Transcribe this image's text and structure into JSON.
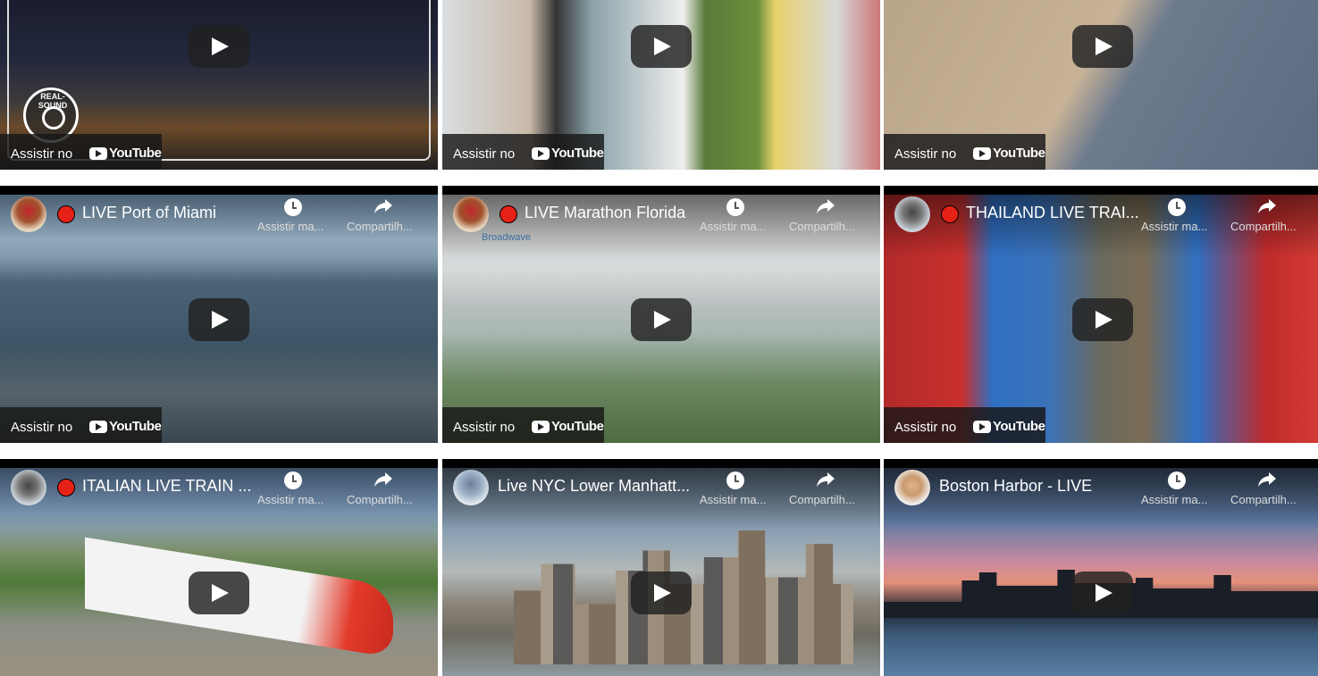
{
  "watch_label": "Assistir no",
  "youtube_word": "YouTube",
  "watch_later_label": "Assistir ma...",
  "share_label": "Compartilh...",
  "realsound_text": "REAL-SOUND",
  "videos": [
    {
      "title": ""
    },
    {
      "title": ""
    },
    {
      "title": ""
    },
    {
      "title": "LIVE Port of Miami",
      "live": true,
      "avatar": "rooster-avatar-icon"
    },
    {
      "title": "LIVE Marathon Florida",
      "live": true,
      "avatar": "rooster-avatar-icon",
      "watermark": "Broadwave"
    },
    {
      "title": "THAILAND LIVE TRAI...",
      "live": true,
      "avatar": "train-avatar-icon"
    },
    {
      "title": "ITALIAN LIVE TRAIN ...",
      "live": true,
      "avatar": "train-avatar-icon"
    },
    {
      "title": "Live NYC Lower Manhatt...",
      "live": false,
      "avatar": "building-avatar-icon"
    },
    {
      "title": "Boston Harbor - LIVE",
      "live": false,
      "avatar": "person-avatar-icon"
    }
  ]
}
